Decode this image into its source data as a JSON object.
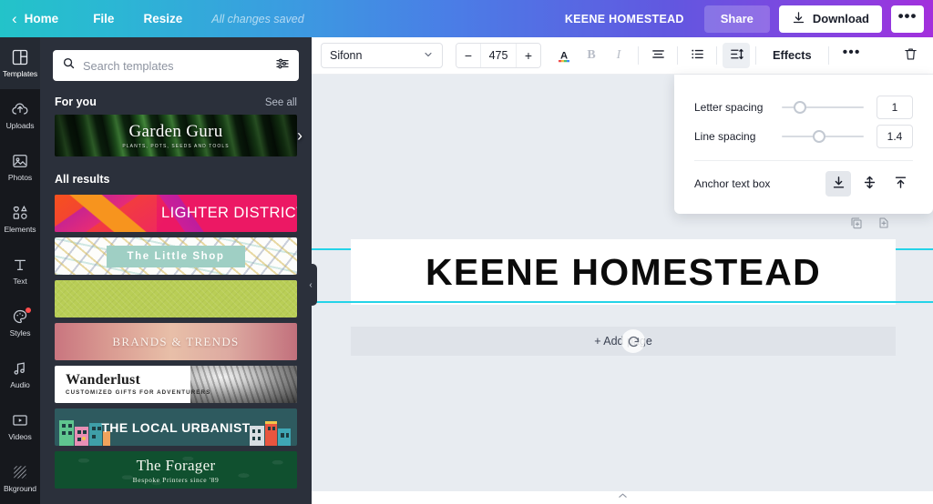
{
  "topbar": {
    "back_icon": "chevron-left-icon",
    "home_label": "Home",
    "file_label": "File",
    "resize_label": "Resize",
    "save_status": "All changes saved",
    "doc_name": "KEENE HOMESTEAD",
    "share_label": "Share",
    "download_label": "Download",
    "download_icon": "download-icon",
    "more_label": "•••",
    "gradient_from": "#23c3c9",
    "gradient_to": "#a32fdc"
  },
  "rail": {
    "items": [
      {
        "label": "Templates",
        "icon": "templates-icon",
        "active": true,
        "badge": false
      },
      {
        "label": "Uploads",
        "icon": "upload-cloud-icon",
        "active": false,
        "badge": false
      },
      {
        "label": "Photos",
        "icon": "photo-icon",
        "active": false,
        "badge": false
      },
      {
        "label": "Elements",
        "icon": "elements-icon",
        "active": false,
        "badge": false
      },
      {
        "label": "Text",
        "icon": "text-icon",
        "active": false,
        "badge": false
      },
      {
        "label": "Styles",
        "icon": "palette-icon",
        "active": false,
        "badge": true
      },
      {
        "label": "Audio",
        "icon": "music-note-icon",
        "active": false,
        "badge": false
      },
      {
        "label": "Videos",
        "icon": "video-icon",
        "active": false,
        "badge": false
      },
      {
        "label": "Bkground",
        "icon": "background-hatch-icon",
        "active": false,
        "badge": false
      }
    ]
  },
  "panel": {
    "search": {
      "placeholder": "Search templates",
      "value": "",
      "search_icon": "search-icon",
      "filter_icon": "sliders-filter-icon"
    },
    "for_you": {
      "title": "For you",
      "see_all": "See all",
      "card_title": "Garden Guru",
      "card_subtitle": "PLANTS, POTS, SEEDS AND TOOLS",
      "next_icon": "chevron-right-icon"
    },
    "all_results_title": "All results",
    "results": [
      {
        "name": "LIGHTER DISTRICT",
        "style": "t1"
      },
      {
        "name": "The Little Shop",
        "style": "t2"
      },
      {
        "name": "",
        "style": "t3"
      },
      {
        "name": "BRANDS & TRENDS",
        "style": "t4"
      },
      {
        "name": "Wanderlust",
        "subtitle": "CUSTOMIZED GIFTS FOR ADVENTURERS",
        "style": "t5"
      },
      {
        "name": "THE LOCAL URBANIST",
        "style": "t6"
      },
      {
        "name": "The Forager",
        "subtitle": "Bespoke Printers since '89",
        "style": "t7"
      }
    ],
    "collapse_icon": "chevron-left-icon"
  },
  "toolbar": {
    "font_name": "Sifonn",
    "font_dropdown_icon": "chevron-down-icon",
    "decrease_label": "−",
    "font_size": "475",
    "increase_label": "+",
    "text_color_icon": "text-color-A-icon",
    "bold_label": "B",
    "italic_label": "I",
    "align_icon": "align-center-icon",
    "list_icon": "bullet-list-icon",
    "spacing_icon": "line-spacing-icon",
    "effects_label": "Effects",
    "more_label": "•••",
    "trash_icon": "trash-icon"
  },
  "spacing_popup": {
    "letter_spacing_label": "Letter spacing",
    "letter_spacing_value": "1",
    "letter_spacing_pct": 22,
    "line_spacing_label": "Line spacing",
    "line_spacing_value": "1.4",
    "line_spacing_pct": 45,
    "anchor_label": "Anchor text box",
    "anchor_options": [
      {
        "icon": "anchor-bottom-icon",
        "active": true
      },
      {
        "icon": "anchor-middle-icon",
        "active": false
      },
      {
        "icon": "anchor-top-icon",
        "active": false
      }
    ]
  },
  "canvas": {
    "duplicate_page_icon": "duplicate-page-icon",
    "add-page_icon": "add-page-icon",
    "design_text": "KEENE HOMESTEAD",
    "selection_color": "#24d3e8",
    "rotate_icon": "rotate-handle-icon",
    "add_page_label": "+ Add page",
    "cursor_icon": "loading-spinner-cursor-icon",
    "bottom_tab_icon": "chevron-up-icon"
  }
}
